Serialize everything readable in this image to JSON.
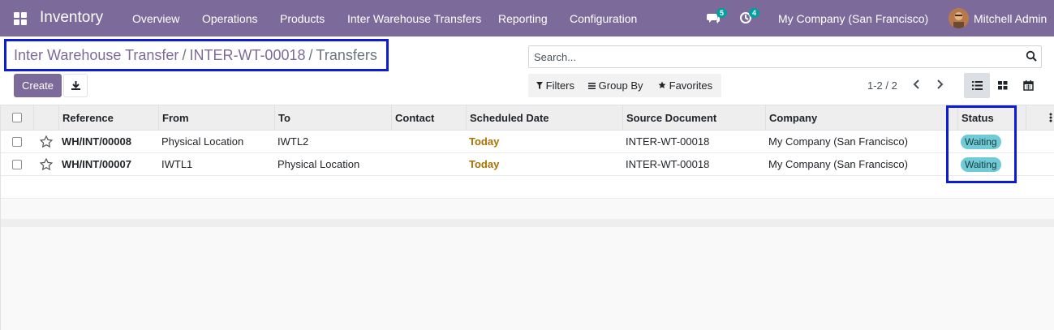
{
  "nav": {
    "brand": "Inventory",
    "menu": [
      "Overview",
      "Operations",
      "Products",
      "Inter Warehouse Transfers",
      "Reporting",
      "Configuration"
    ],
    "chat_count": "5",
    "activity_count": "4",
    "company": "My Company (San Francisco)",
    "user": "Mitchell Admin"
  },
  "breadcrumb": {
    "item1": "Inter Warehouse Transfer",
    "item2": "INTER-WT-00018",
    "current": "Transfers",
    "sep": "/"
  },
  "buttons": {
    "create": "Create"
  },
  "search": {
    "placeholder": "Search..."
  },
  "filters": {
    "filters": "Filters",
    "group_by": "Group By",
    "favorites": "Favorites"
  },
  "pager": "1-2 / 2",
  "table": {
    "headers": [
      "Reference",
      "From",
      "To",
      "Contact",
      "Scheduled Date",
      "Source Document",
      "Company",
      "Status"
    ],
    "rows": [
      {
        "reference": "WH/INT/00008",
        "from": "Physical Location",
        "to": "IWTL2",
        "contact": "",
        "scheduled": "Today",
        "source": "INTER-WT-00018",
        "company": "My Company (San Francisco)",
        "status": "Waiting"
      },
      {
        "reference": "WH/INT/00007",
        "from": "IWTL1",
        "to": "Physical Location",
        "contact": "",
        "scheduled": "Today",
        "source": "INTER-WT-00018",
        "company": "My Company (San Francisco)",
        "status": "Waiting"
      }
    ]
  },
  "colors": {
    "brand": "#7c6a9b",
    "highlight": "#0c1cd6",
    "today": "#a87100",
    "waiting": "#6fcbd6"
  }
}
